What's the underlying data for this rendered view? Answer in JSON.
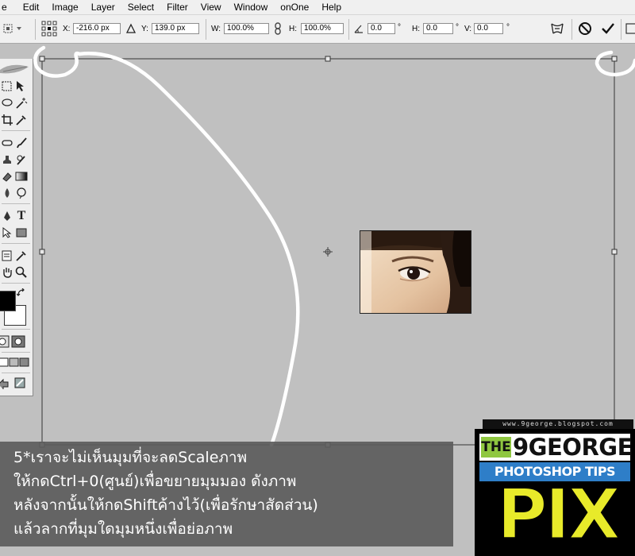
{
  "menu": [
    "e",
    "Edit",
    "Image",
    "Layer",
    "Select",
    "Filter",
    "View",
    "Window",
    "onOne",
    "Help"
  ],
  "options": {
    "x_label": "X:",
    "x_value": "-216.0 px",
    "y_label": "Y:",
    "y_value": "139.0 px",
    "w_label": "W:",
    "w_value": "100.0%",
    "h_label": "H:",
    "h_value": "100.0%",
    "angle_value": "0.0",
    "angle_unit": "°",
    "hskew_label": "H:",
    "hskew_value": "0.0",
    "hskew_unit": "°",
    "vskew_label": "V:",
    "vskew_value": "0.0",
    "vskew_unit": "°"
  },
  "caption": [
    "5*เราจะไม่เห็นมุมที่จะลดScaleภาพ",
    "ให้กดCtrl+0(ศูนย์)เพื่อขยายมุมมอง ดังภาพ",
    "หลังจากนั้นให้กดShiftค้างไว้(เพื่อรักษาสัดส่วน)",
    "แล้วลากที่มุมใดมุมหนึ่งเพื่อย่อภาพ"
  ],
  "logo": {
    "url": "www.9george.blogspot.com",
    "the": "THE",
    "brand": "9GEORGE",
    "sub": "PHOTOSHOP TIPS",
    "pix": "PIX"
  },
  "colors": {
    "canvas": "#c0c0c0",
    "caption_bg": "#5c5c5c",
    "logo_yellow": "#e8ea2a",
    "logo_blue": "#2e7ec8",
    "logo_green": "#8fc740"
  }
}
